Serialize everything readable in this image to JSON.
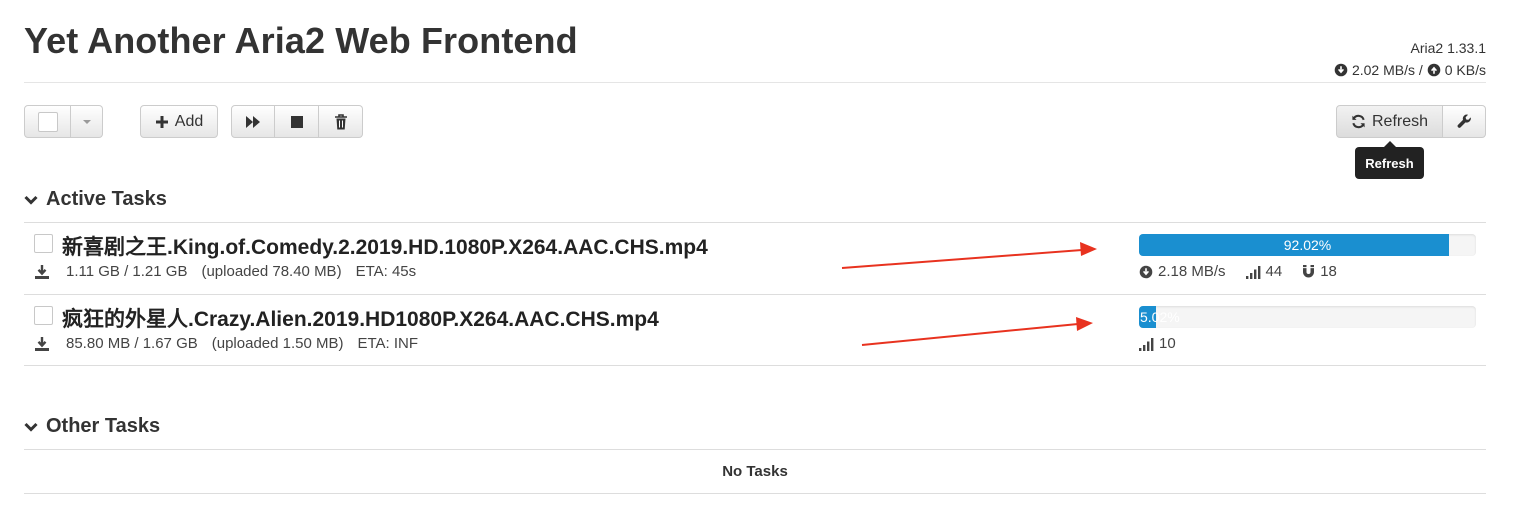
{
  "app": {
    "title": "Yet Another Aria2 Web Frontend",
    "version": "Aria2 1.33.1",
    "download_speed": "2.02 MB/s /",
    "upload_speed": "0 KB/s"
  },
  "toolbar": {
    "add_label": "Add",
    "refresh_label": "Refresh",
    "refresh_tooltip": "Refresh",
    "icons": [
      "checkbox-icon",
      "caret-down-icon",
      "plus-icon",
      "fast-forward-icon",
      "stop-icon",
      "trash-icon",
      "refresh-icon",
      "wrench-icon"
    ]
  },
  "active_section": {
    "title": "Active Tasks",
    "tasks": [
      {
        "name": "新喜剧之王.King.of.Comedy.2.2019.HD.1080P.X264.AAC.CHS.mp4",
        "size": "1.11 GB / 1.21 GB",
        "uploaded": "(uploaded 78.40 MB)",
        "eta": "ETA: 45s",
        "progress_percent": 92.02,
        "progress_label": "92.02%",
        "speed": "2.18 MB/s",
        "connections": "44",
        "seeders": "18"
      },
      {
        "name": "疯狂的外星人.Crazy.Alien.2019.HD1080P.X264.AAC.CHS.mp4",
        "size": "85.80 MB / 1.67 GB",
        "uploaded": "(uploaded 1.50 MB)",
        "eta": "ETA: INF",
        "progress_percent": 5.02,
        "progress_label": "5.02%",
        "connections": "10"
      }
    ]
  },
  "other_section": {
    "title": "Other Tasks",
    "empty_text": "No Tasks"
  },
  "colors": {
    "progress": "#1a8fd0",
    "arrow": "#e8321f",
    "tooltip_bg": "#222222"
  }
}
